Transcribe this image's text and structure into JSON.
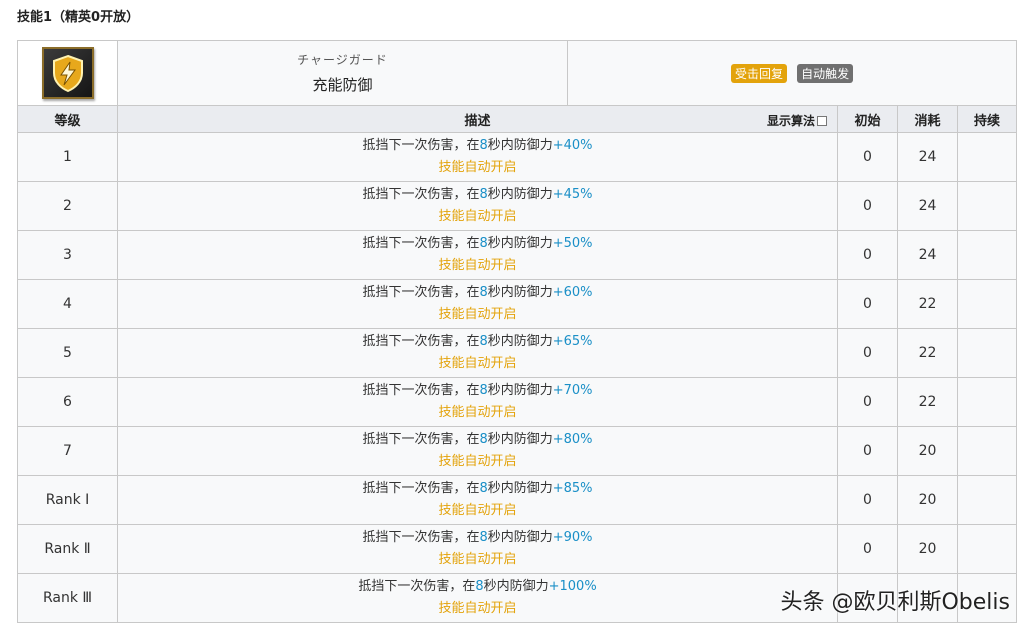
{
  "section_title": "技能1（精英0开放）",
  "skill": {
    "icon": "shield-bolt-icon",
    "jp_name": "チャージガード",
    "cn_name": "充能防御",
    "tags": [
      "受击回复",
      "自动触发"
    ]
  },
  "columns": {
    "level": "等级",
    "desc": "描述",
    "algo_toggle": "显示算法",
    "initial": "初始",
    "cost": "消耗",
    "duration": "持续"
  },
  "desc_parts": {
    "prefix": "抵挡下一次伤害，在",
    "seconds": "8",
    "middle": "秒内防御力",
    "auto": "技能自动开启"
  },
  "rows": [
    {
      "level": "1",
      "bonus": "+40%",
      "initial": "0",
      "cost": "24",
      "duration": ""
    },
    {
      "level": "2",
      "bonus": "+45%",
      "initial": "0",
      "cost": "24",
      "duration": ""
    },
    {
      "level": "3",
      "bonus": "+50%",
      "initial": "0",
      "cost": "24",
      "duration": ""
    },
    {
      "level": "4",
      "bonus": "+60%",
      "initial": "0",
      "cost": "22",
      "duration": ""
    },
    {
      "level": "5",
      "bonus": "+65%",
      "initial": "0",
      "cost": "22",
      "duration": ""
    },
    {
      "level": "6",
      "bonus": "+70%",
      "initial": "0",
      "cost": "22",
      "duration": ""
    },
    {
      "level": "7",
      "bonus": "+80%",
      "initial": "0",
      "cost": "20",
      "duration": ""
    },
    {
      "level": "Rank Ⅰ",
      "bonus": "+85%",
      "initial": "0",
      "cost": "20",
      "duration": ""
    },
    {
      "level": "Rank Ⅱ",
      "bonus": "+90%",
      "initial": "0",
      "cost": "20",
      "duration": ""
    },
    {
      "level": "Rank Ⅲ",
      "bonus": "+100%",
      "initial": "",
      "cost": "",
      "duration": ""
    }
  ],
  "watermark": "头条 @欧贝利斯Obelis",
  "colors": {
    "accent_blue": "#1a8fc7",
    "accent_orange": "#e3a30b",
    "tag_gray": "#707070"
  }
}
